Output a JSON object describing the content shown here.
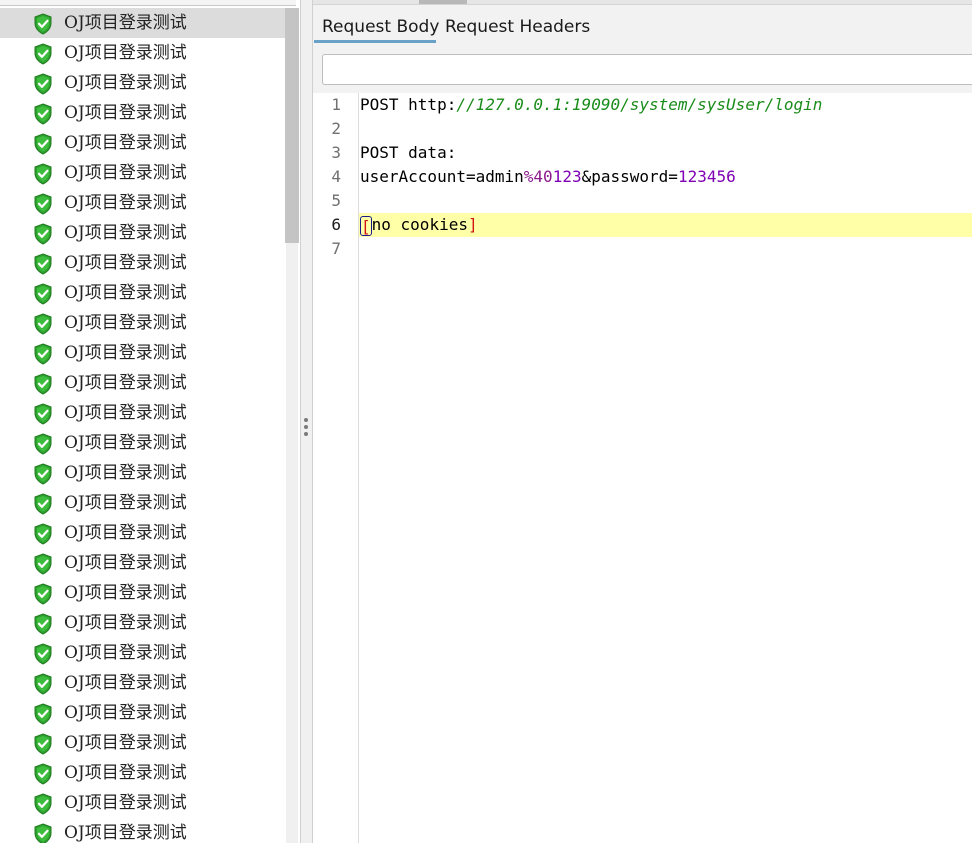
{
  "tree": {
    "items": [
      {
        "label": "OJ项目登录测试",
        "status": "success",
        "selected": true
      },
      {
        "label": "OJ项目登录测试",
        "status": "success"
      },
      {
        "label": "OJ项目登录测试",
        "status": "success"
      },
      {
        "label": "OJ项目登录测试",
        "status": "success"
      },
      {
        "label": "OJ项目登录测试",
        "status": "success"
      },
      {
        "label": "OJ项目登录测试",
        "status": "success"
      },
      {
        "label": "OJ项目登录测试",
        "status": "success"
      },
      {
        "label": "OJ项目登录测试",
        "status": "success"
      },
      {
        "label": "OJ项目登录测试",
        "status": "success"
      },
      {
        "label": "OJ项目登录测试",
        "status": "success"
      },
      {
        "label": "OJ项目登录测试",
        "status": "success"
      },
      {
        "label": "OJ项目登录测试",
        "status": "success"
      },
      {
        "label": "OJ项目登录测试",
        "status": "success"
      },
      {
        "label": "OJ项目登录测试",
        "status": "success"
      },
      {
        "label": "OJ项目登录测试",
        "status": "success"
      },
      {
        "label": "OJ项目登录测试",
        "status": "success"
      },
      {
        "label": "OJ项目登录测试",
        "status": "success"
      },
      {
        "label": "OJ项目登录测试",
        "status": "success"
      },
      {
        "label": "OJ项目登录测试",
        "status": "success"
      },
      {
        "label": "OJ项目登录测试",
        "status": "success"
      },
      {
        "label": "OJ项目登录测试",
        "status": "success"
      },
      {
        "label": "OJ项目登录测试",
        "status": "success"
      },
      {
        "label": "OJ项目登录测试",
        "status": "success"
      },
      {
        "label": "OJ项目登录测试",
        "status": "success"
      },
      {
        "label": "OJ项目登录测试",
        "status": "success"
      },
      {
        "label": "OJ项目登录测试",
        "status": "success"
      },
      {
        "label": "OJ项目登录测试",
        "status": "success"
      },
      {
        "label": "OJ项目登录测试",
        "status": "success"
      }
    ],
    "icon": "green-shield-check-icon"
  },
  "tabs": {
    "body": "Request Body",
    "headers": "Request Headers",
    "active": "body"
  },
  "search": {
    "value": ""
  },
  "editor": {
    "line_numbers": [
      "1",
      "2",
      "3",
      "4",
      "5",
      "6",
      "7"
    ],
    "line1": {
      "method": "POST http:",
      "url": "//127.0.0.1:19090/system/sysUser/login"
    },
    "line3": {
      "text": "POST data:"
    },
    "line4": {
      "key1": "userAccount",
      "eq1": "=",
      "val1_a": "admin",
      "val1_esc": "%40",
      "val1_b": "123",
      "amp": "&",
      "key2": "password",
      "eq2": "=",
      "val2": "123456"
    },
    "line6": {
      "open": "[",
      "text": "no cookies",
      "close": "]"
    },
    "highlighted_line": 6
  },
  "colors": {
    "url": "#1a8c1a",
    "escape": "#8b1a8b",
    "number": "#7f00b5",
    "bracket": "#d11414",
    "line_highlight": "#ffffa8",
    "tab_underline": "#6aa1c8",
    "shield_green": "#2fa12f"
  }
}
